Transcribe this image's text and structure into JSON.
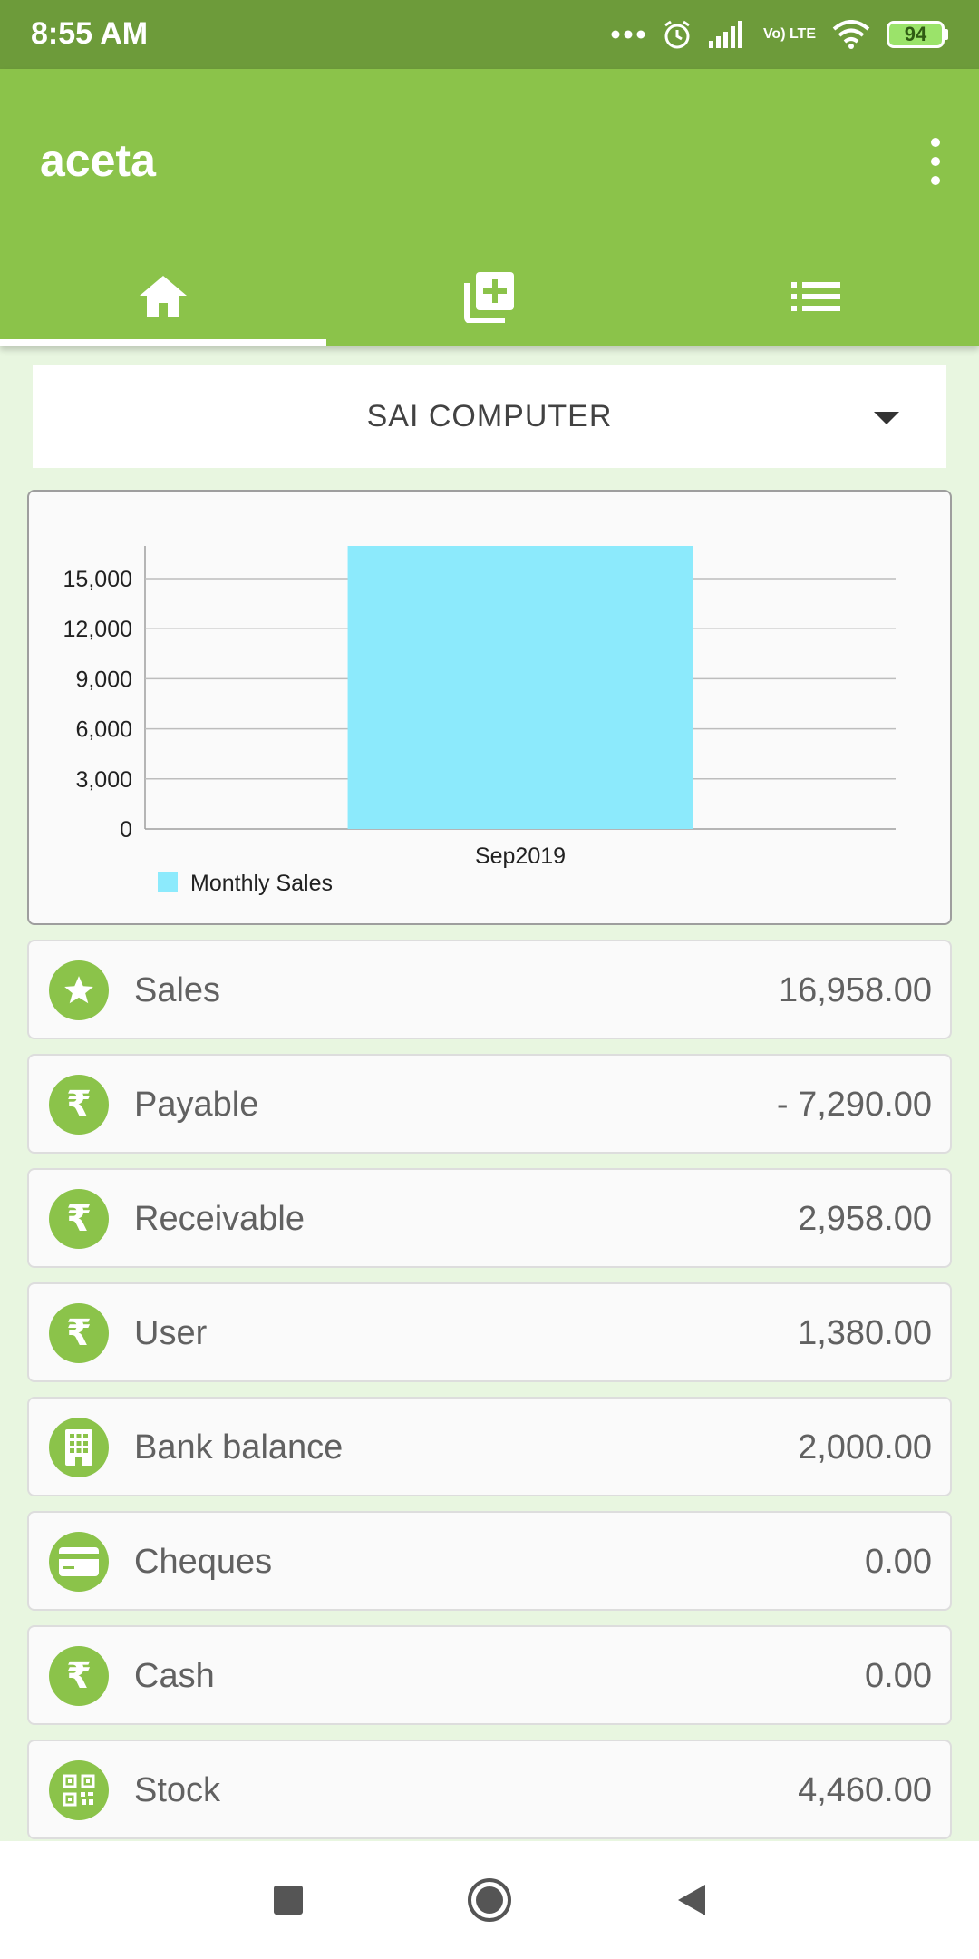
{
  "status_bar": {
    "time": "8:55 AM",
    "battery": "94",
    "network_label": "Vo) LTE"
  },
  "app": {
    "title": "aceta"
  },
  "tabs": [
    {
      "icon": "home-icon",
      "selected": true
    },
    {
      "icon": "add-note-icon",
      "selected": false
    },
    {
      "icon": "list-icon",
      "selected": false
    }
  ],
  "company_dropdown": {
    "selected": "SAI COMPUTER"
  },
  "chart_data": {
    "type": "bar",
    "categories": [
      "Sep2019"
    ],
    "series": [
      {
        "name": "Monthly Sales",
        "values": [
          16958
        ],
        "color": "#8ceafc"
      }
    ],
    "yticks": [
      "0",
      "3,000",
      "6,000",
      "9,000",
      "12,000",
      "15,000"
    ],
    "ylim": [
      0,
      16958
    ],
    "grid": true,
    "legend": "bottom-left",
    "title": "",
    "xlabel": "",
    "ylabel": ""
  },
  "summary_rows": [
    {
      "label": "Sales",
      "value": "16,958.00",
      "icon": "star-icon"
    },
    {
      "label": "Payable",
      "value": "- 7,290.00",
      "icon": "rupee-icon"
    },
    {
      "label": "Receivable",
      "value": "2,958.00",
      "icon": "rupee-icon"
    },
    {
      "label": "User",
      "value": "1,380.00",
      "icon": "rupee-icon"
    },
    {
      "label": "Bank balance",
      "value": "2,000.00",
      "icon": "bank-building-icon"
    },
    {
      "label": "Cheques",
      "value": "0.00",
      "icon": "credit-card-icon"
    },
    {
      "label": "Cash",
      "value": "0.00",
      "icon": "rupee-icon"
    },
    {
      "label": "Stock",
      "value": "4,460.00",
      "icon": "qr-code-icon"
    }
  ],
  "colors": {
    "primary": "#8bc34a",
    "status_bar": "#6d9b3a",
    "bar": "#8ceafc",
    "background": "#e8f6e0"
  }
}
